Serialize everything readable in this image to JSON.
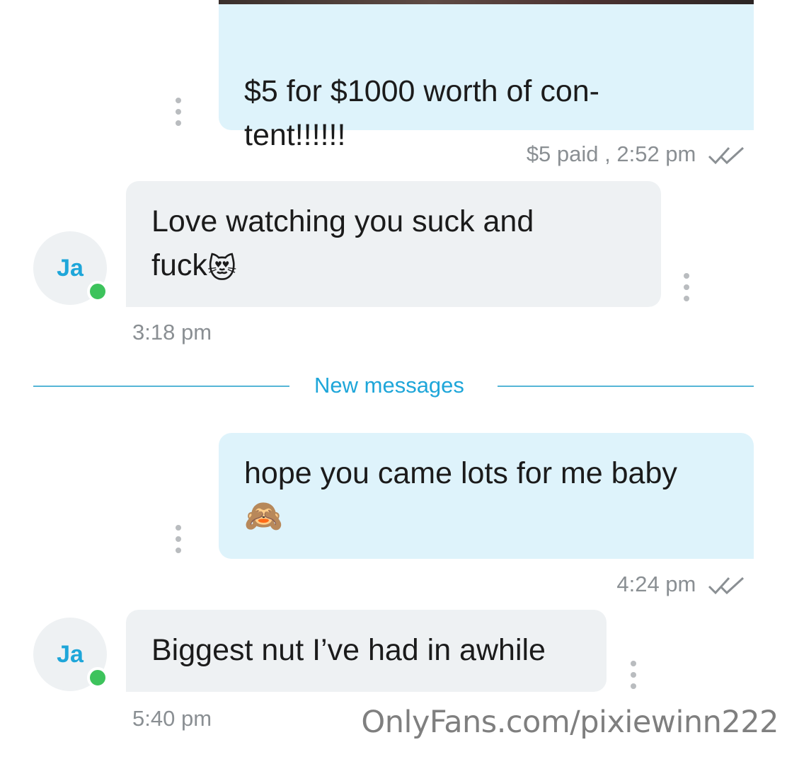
{
  "messages": [
    {
      "direction": "outgoing",
      "text": "$5 for $1000 worth of con-\ntent!!!!!!",
      "meta": "$5 paid , 2:52 pm",
      "status": "read-double-check-icon"
    },
    {
      "direction": "incoming",
      "avatar_initials": "Ja",
      "text": "Love watching you suck and\nfuck",
      "emoji": "😻",
      "time": "3:18 pm"
    },
    {
      "direction": "outgoing",
      "text": "hope you came lots for me baby",
      "emoji": "🙈",
      "time": "4:24 pm",
      "status": "read-double-check-icon"
    },
    {
      "direction": "incoming",
      "avatar_initials": "Ja",
      "text": "Biggest nut I’ve had in awhile",
      "time": "5:40 pm"
    }
  ],
  "divider": {
    "label": "New messages"
  },
  "watermark": "OnlyFans.com/pixiewinn222",
  "colors": {
    "outgoing_bubble": "#def3fb",
    "incoming_bubble": "#eef1f3",
    "accent": "#1ea6d9",
    "online": "#3dc35c"
  }
}
